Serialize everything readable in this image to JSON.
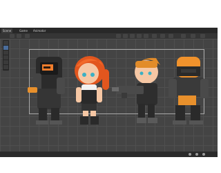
{
  "tabs": [
    {
      "label": "Scene"
    },
    {
      "label": "Game"
    },
    {
      "label": "Animator"
    }
  ],
  "icons": [
    "hand-icon",
    "move-icon",
    "rotate-icon",
    "scale-icon",
    "rect-icon",
    "transform-icon",
    "gizmo-icon",
    "camera-icon",
    "search-icon",
    "layers-icon"
  ],
  "characters": [
    "robot-left",
    "red-haired-girl",
    "gunner-man",
    "robot-right"
  ]
}
